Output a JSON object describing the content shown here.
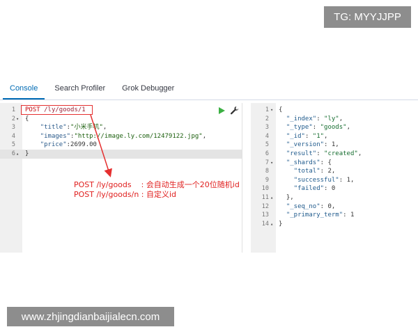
{
  "watermarks": {
    "top": "TG: MYYJJPP",
    "bottom": "www.zhjingdianbaijialecn.com"
  },
  "tabs": [
    {
      "label": "Console",
      "active": true
    },
    {
      "label": "Search Profiler",
      "active": false
    },
    {
      "label": "Grok Debugger",
      "active": false
    }
  ],
  "request": {
    "lines": [
      {
        "num": "1",
        "fold": "",
        "method": "POST",
        "url": " /ly/goods/1"
      },
      {
        "num": "2",
        "fold": "▾",
        "text": "{"
      },
      {
        "num": "3",
        "fold": "",
        "key": "\"title\"",
        "val": "\"小米手机\"",
        "tail": ","
      },
      {
        "num": "4",
        "fold": "",
        "key": "\"images\"",
        "val": "\"http://image.ly.com/12479122.jpg\"",
        "tail": ","
      },
      {
        "num": "5",
        "fold": "",
        "key": "\"price\"",
        "val": "2699.00",
        "tail": ""
      },
      {
        "num": "6",
        "fold": "▴",
        "text": "}"
      }
    ]
  },
  "annotation": {
    "line1": "POST /ly/goods    : 会自动生成一个20位随机id",
    "line2": "POST /ly/goods/n : 自定义id"
  },
  "response": {
    "lines": [
      {
        "num": "1",
        "fold": "▾",
        "text": "{"
      },
      {
        "num": "2",
        "fold": "",
        "key": "\"_index\"",
        "val": "\"ly\"",
        "tail": ","
      },
      {
        "num": "3",
        "fold": "",
        "key": "\"_type\"",
        "val": "\"goods\"",
        "tail": ","
      },
      {
        "num": "4",
        "fold": "",
        "key": "\"_id\"",
        "val": "\"1\"",
        "tail": ","
      },
      {
        "num": "5",
        "fold": "",
        "key": "\"_version\"",
        "val": "1",
        "tail": ","
      },
      {
        "num": "6",
        "fold": "",
        "key": "\"result\"",
        "val": "\"created\"",
        "tail": ","
      },
      {
        "num": "7",
        "fold": "▾",
        "key": "\"_shards\"",
        "val": "{",
        "tail": ""
      },
      {
        "num": "8",
        "fold": "",
        "key": "\"total\"",
        "val": "2",
        "tail": ",",
        "indent": 2
      },
      {
        "num": "9",
        "fold": "",
        "key": "\"successful\"",
        "val": "1",
        "tail": ",",
        "indent": 2
      },
      {
        "num": "10",
        "fold": "",
        "key": "\"failed\"",
        "val": "0",
        "tail": "",
        "indent": 2
      },
      {
        "num": "11",
        "fold": "▴",
        "text": "  },"
      },
      {
        "num": "12",
        "fold": "",
        "key": "\"_seq_no\"",
        "val": "0",
        "tail": ","
      },
      {
        "num": "13",
        "fold": "",
        "key": "\"_primary_term\"",
        "val": "1",
        "tail": ""
      },
      {
        "num": "14",
        "fold": "▴",
        "text": "}"
      }
    ]
  },
  "colors": {
    "accent": "#006bb4",
    "annotation": "#e0201f",
    "run": "#3cb043"
  }
}
